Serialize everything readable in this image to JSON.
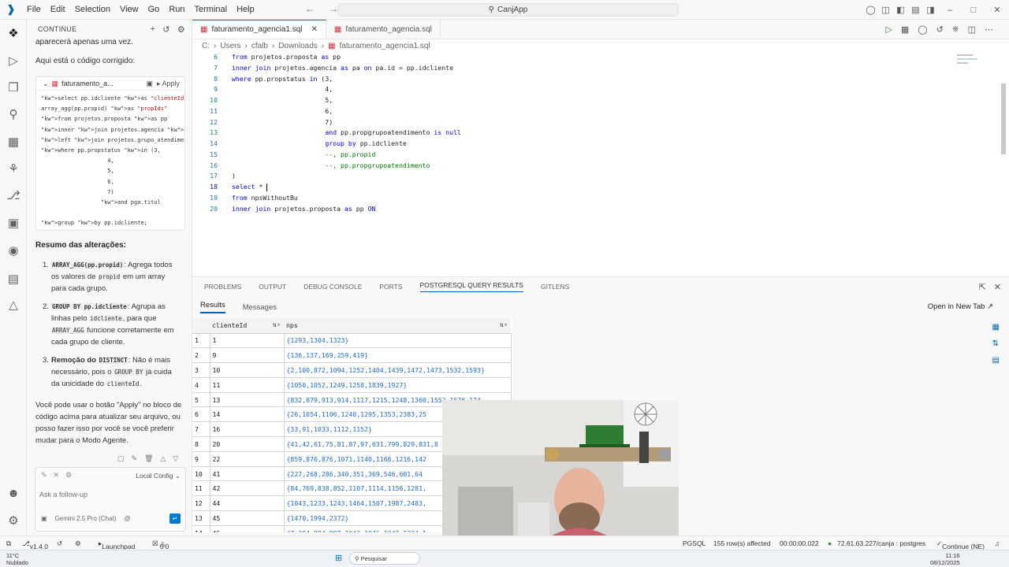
{
  "menu": [
    "File",
    "Edit",
    "Selection",
    "View",
    "Go",
    "Run",
    "Terminal",
    "Help"
  ],
  "search": {
    "label": "CanjApp"
  },
  "chat": {
    "header": "CONTINUE",
    "intro_tail": "aparecerá apenas uma vez.",
    "intro": "Aqui está o código corrigido:",
    "code_file": "faturamento_a...",
    "code_apply": "Apply",
    "code_lines": [
      "select pp.idcliente as \"clienteId\",",
      "array_agg(pp.propid) as \"propIds\"",
      "from projetos.proposta as pp",
      "inner join projetos.agencia as pa on pa",
      "left join projetos.grupo_atendimento as",
      "where pp.propstatus in (3,",
      "                    4,",
      "                    5,",
      "                    6,",
      "                    7)",
      "                  and pga.titul",
      "",
      "group by pp.idcliente;"
    ],
    "summary_title": "Resumo das alterações:",
    "items": [
      {
        "num": "1.",
        "code": "ARRAY_AGG(pp.propid)",
        "text": ": Agrega todos os valores de ",
        "code2": "propid",
        "text2": " em um array para cada grupo."
      },
      {
        "num": "2.",
        "code": "GROUP BY pp.idcliente",
        "text": ": Agrupa as linhas pelo ",
        "code2": "idcliente",
        "text2": ", para que ",
        "code3": "ARRAY_AGG",
        "text3": " funcione corretamente em cada grupo de cliente."
      },
      {
        "num": "3.",
        "bold": "Remoção do ",
        "code": "DISTINCT",
        "text": ": Não é mais necessário, pois o ",
        "code2": "GROUP BY",
        "text2": " já cuida da unicidade do ",
        "code3": "clienteId",
        "text3": "."
      }
    ],
    "closing": "Você pode usar o botão \"Apply\" no bloco de código acima para atualizar seu arquivo, ou posso fazer isso por você se você preferir mudar para o Modo Agente.",
    "local_config": "Local Config",
    "followup_placeholder": "Ask a follow-up",
    "model": "Gemini 2.5 Pro (Chat)"
  },
  "tabs": [
    {
      "label": "faturamento_agencia1.sql",
      "active": true
    },
    {
      "label": "faturamento_agencia.sql",
      "active": false
    }
  ],
  "breadcrumb": [
    "C:",
    "Users",
    "cfalb",
    "Downloads",
    "faturamento_agencia1.sql"
  ],
  "editor_lines": [
    {
      "n": "6",
      "html": "from projetos.proposta as pp"
    },
    {
      "n": "7",
      "html": "inner join projetos.agencia as pa on pa.id = pp.idcliente"
    },
    {
      "n": "8",
      "html": "where pp.propstatus in (3,"
    },
    {
      "n": "9",
      "html": "                        4,"
    },
    {
      "n": "10",
      "html": "                        5,"
    },
    {
      "n": "11",
      "html": "                        6,"
    },
    {
      "n": "12",
      "html": "                        7)"
    },
    {
      "n": "13",
      "html": "                        and pp.propgrupoatendimento is null"
    },
    {
      "n": "14",
      "html": "                        group by pp.idcliente"
    },
    {
      "n": "15",
      "html": "                        --, pp.propid"
    },
    {
      "n": "16",
      "html": "                        --, pp.propgrupoatendimento"
    },
    {
      "n": "17",
      "html": ")"
    },
    {
      "n": "18",
      "html": "select * "
    },
    {
      "n": "19",
      "html": "from npsWithoutBu"
    },
    {
      "n": "20",
      "html": "inner join projetos.proposta as pp ON"
    }
  ],
  "panel_tabs": [
    "PROBLEMS",
    "OUTPUT",
    "DEBUG CONSOLE",
    "PORTS",
    "POSTGRESQL QUERY RESULTS",
    "GITLENS"
  ],
  "results": {
    "tabs": [
      "Results",
      "Messages"
    ],
    "open_new_tab": "Open in New Tab",
    "columns": [
      "clienteId",
      "nps"
    ],
    "rows": [
      [
        "1",
        "1",
        "{1293,1304,1323}"
      ],
      [
        "2",
        "9",
        "{136,137,169,259,419}"
      ],
      [
        "3",
        "10",
        "{2,100,872,1094,1252,1404,1439,1472,1473,1532,1593}"
      ],
      [
        "4",
        "11",
        "{1050,1052,1249,1258,1839,1927}"
      ],
      [
        "5",
        "13",
        "{832,879,913,914,1117,1215,1248,1360,1552,1576,174"
      ],
      [
        "6",
        "14",
        "{26,1054,1106,1240,1295,1353,2383,25"
      ],
      [
        "7",
        "16",
        "{33,91,1033,1112,1152}"
      ],
      [
        "8",
        "20",
        "{41,42,61,75,81,87,97,631,799,829,831,8"
      ],
      [
        "9",
        "22",
        "{859,870,876,1071,1140,1166,1216,142"
      ],
      [
        "10",
        "41",
        "{227,268,286,340,351,369,546,601,64"
      ],
      [
        "11",
        "42",
        "{84,769,838,852,1107,1114,1156,1281,"
      ],
      [
        "12",
        "44",
        "{1043,1233,1243,1464,1507,1987,2483,"
      ],
      [
        "13",
        "45",
        "{1470,1994,2372}"
      ],
      [
        "14",
        "46",
        "{7,204,994,997,1043,1046,1047,1224,1"
      ]
    ]
  },
  "status": {
    "version": "v1.4.0",
    "launchpad": "Launchpad",
    "errors": "0",
    "warnings": "0",
    "lang": "PGSQL",
    "rows_affected": "155 row(s) affected",
    "time": "00:00:00.022",
    "connection": "72.61.63.227/canja : postgres",
    "continue": "Continue (NE)"
  },
  "taskbar": {
    "weather": "11°C",
    "weather_sub": "Nublado",
    "search": "Pesquisar",
    "clock": "11:16",
    "date": "08/12/2025"
  }
}
